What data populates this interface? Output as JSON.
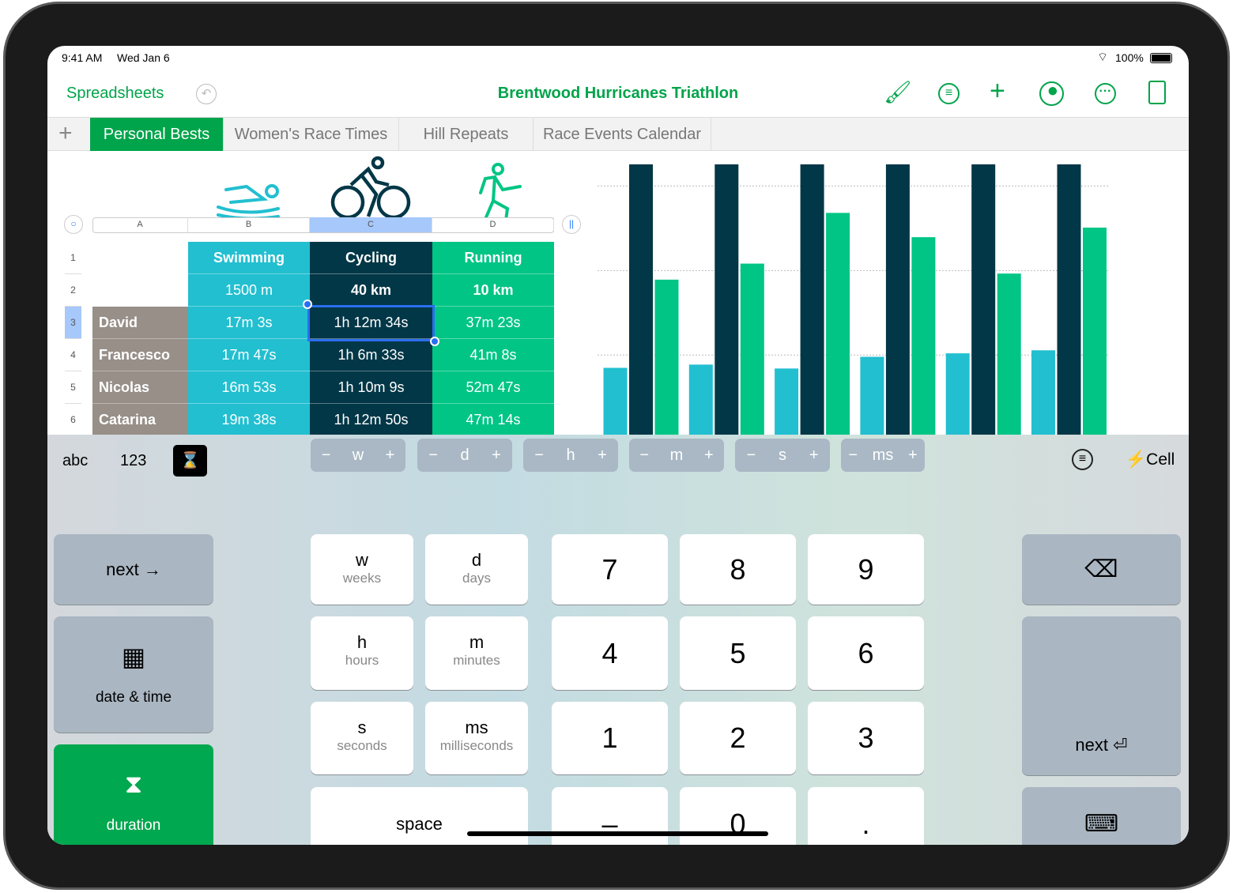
{
  "status": {
    "time": "9:41 AM",
    "date": "Wed Jan 6",
    "battery": "100%"
  },
  "toolbar": {
    "back": "Spreadsheets",
    "title": "Brentwood Hurricanes Triathlon",
    "icons": [
      "undo-icon",
      "paintbrush-icon",
      "filter-icon",
      "plus-icon",
      "collaborate-icon",
      "more-icon",
      "reading-view-icon"
    ]
  },
  "tabs": [
    {
      "label": "Personal Bests",
      "active": true
    },
    {
      "label": "Women's Race Times"
    },
    {
      "label": "Hill Repeats"
    },
    {
      "label": "Race Events Calendar"
    }
  ],
  "table": {
    "columns": [
      "A",
      "B",
      "C",
      "D"
    ],
    "rows": [
      "1",
      "2",
      "3",
      "4",
      "5",
      "6"
    ],
    "headers": [
      "Swimming",
      "Cycling",
      "Running"
    ],
    "distances": [
      "1500 m",
      "40 km",
      "10 km"
    ],
    "data": [
      {
        "name": "David",
        "swim": "17m 3s",
        "cycle": "1h 12m 34s",
        "run": "37m 23s"
      },
      {
        "name": "Francesco",
        "swim": "17m 47s",
        "cycle": "1h 6m 33s",
        "run": "41m 8s"
      },
      {
        "name": "Nicolas",
        "swim": "16m 53s",
        "cycle": "1h 10m 9s",
        "run": "52m 47s"
      },
      {
        "name": "Catarina",
        "swim": "19m 38s",
        "cycle": "1h 12m 50s",
        "run": "47m 14s"
      }
    ],
    "selected_cell": "C3",
    "colors": {
      "swim": "#22bfd0",
      "cycle": "#023747",
      "run": "#00c584",
      "name": "#978f88"
    }
  },
  "chart_data": {
    "type": "bar",
    "grid": true,
    "categories": [
      "1",
      "2",
      "3",
      "4",
      "5",
      "6"
    ],
    "series": [
      {
        "values": [
          17.05,
          17.8,
          16.9,
          19.6,
          20.4,
          21.1
        ],
        "color": "#22bfd0"
      },
      {
        "values": [
          72.6,
          66.6,
          70.2,
          72.8,
          77.9,
          67.1
        ],
        "color": "#023747"
      },
      {
        "values": [
          37.4,
          41.1,
          52.8,
          47.2,
          38.8,
          49.4
        ],
        "color": "#00c584"
      }
    ]
  },
  "keyboard": {
    "modes": [
      "abc",
      "123"
    ],
    "steppers": [
      "w",
      "d",
      "h",
      "m",
      "s",
      "ms"
    ],
    "cell_label": "Cell",
    "left": {
      "next": "next",
      "date_time": "date & time",
      "duration": "duration"
    },
    "units": [
      {
        "k": "w",
        "l": "weeks"
      },
      {
        "k": "d",
        "l": "days"
      },
      {
        "k": "h",
        "l": "hours"
      },
      {
        "k": "m",
        "l": "minutes"
      },
      {
        "k": "s",
        "l": "seconds"
      },
      {
        "k": "ms",
        "l": "milliseconds"
      }
    ],
    "digits": [
      "7",
      "8",
      "9",
      "4",
      "5",
      "6",
      "1",
      "2",
      "3",
      "–",
      "0",
      "."
    ],
    "space": "space",
    "next_return": "next"
  }
}
